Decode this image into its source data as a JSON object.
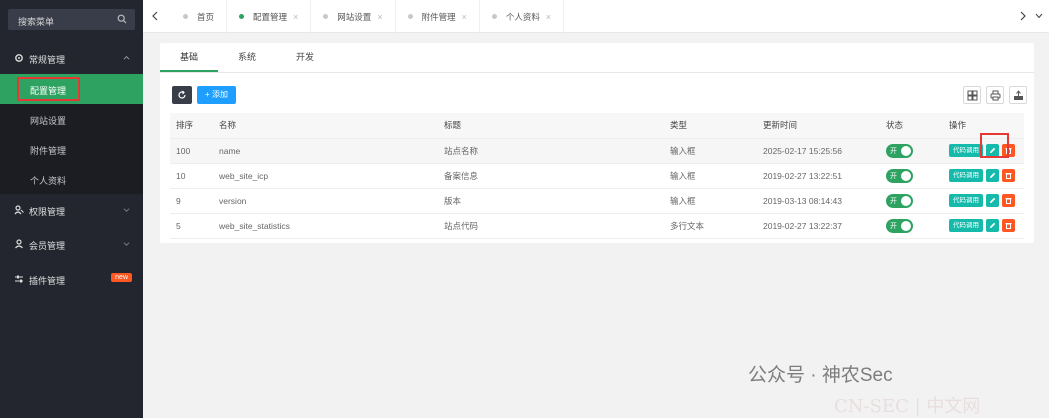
{
  "sidebar": {
    "search_label": "搜索菜单",
    "groups": [
      {
        "label": "常规管理"
      },
      {
        "label": "权限管理"
      },
      {
        "label": "会员管理"
      },
      {
        "label": "插件管理",
        "badge": "new"
      }
    ],
    "sub_items": [
      {
        "label": "配置管理"
      },
      {
        "label": "网站设置"
      },
      {
        "label": "附件管理"
      },
      {
        "label": "个人资料"
      }
    ]
  },
  "tabs": [
    {
      "label": "首页"
    },
    {
      "label": "配置管理",
      "close": "×"
    },
    {
      "label": "网站设置",
      "close": "×"
    },
    {
      "label": "附件管理",
      "close": "×"
    },
    {
      "label": "个人资料",
      "close": "×"
    }
  ],
  "subtabs": [
    {
      "label": "基础"
    },
    {
      "label": "系统"
    },
    {
      "label": "开发"
    }
  ],
  "toolbar": {
    "add_label": "+ 添加"
  },
  "table": {
    "headers": [
      "排序",
      "名称",
      "标题",
      "类型",
      "更新时间",
      "状态",
      "操作"
    ],
    "rows": [
      {
        "sort": "100",
        "name": "name",
        "title": "站点名称",
        "type": "输入框",
        "time": "2025-02-17 15:25:56"
      },
      {
        "sort": "10",
        "name": "web_site_icp",
        "title": "备案信息",
        "type": "输入框",
        "time": "2019-02-27 13:22:51"
      },
      {
        "sort": "9",
        "name": "version",
        "title": "版本",
        "type": "输入框",
        "time": "2019-03-13 08:14:43"
      },
      {
        "sort": "5",
        "name": "web_site_statistics",
        "title": "站点代码",
        "type": "多行文本",
        "time": "2019-02-27 13:22:37"
      }
    ],
    "switch_label": "开",
    "code_label": "代码调用"
  },
  "watermark": {
    "line1": "公众号 · 神农Sec",
    "line2": "CN-SEC | 中文网"
  },
  "colors": {
    "sidebar": "#23262e",
    "active": "#2ea361",
    "primary": "#1e9fff",
    "teal": "#16baaa",
    "danger": "#ff5722"
  }
}
